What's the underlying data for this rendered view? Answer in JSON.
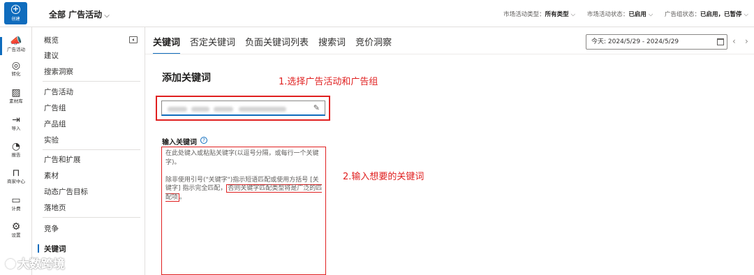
{
  "topbar": {
    "create_label": "创建",
    "campaign_selector": "全部 广告活动",
    "filters": [
      {
        "label": "市场活动类型：",
        "value": "所有类型"
      },
      {
        "label": "市场活动状态：",
        "value": "已启用"
      },
      {
        "label": "广告组状态：",
        "value": "已启用，已暂停"
      }
    ]
  },
  "rail": {
    "items": [
      {
        "label": "广告活动",
        "icon": "megaphone-icon"
      },
      {
        "label": "转化",
        "icon": "target-icon"
      },
      {
        "label": "素材库",
        "icon": "image-edit-icon"
      },
      {
        "label": "导入",
        "icon": "import-icon"
      },
      {
        "label": "报告",
        "icon": "chart-pie-icon"
      },
      {
        "label": "商家中心",
        "icon": "shopping-bag-icon"
      },
      {
        "label": "计费",
        "icon": "billing-icon"
      },
      {
        "label": "设置",
        "icon": "gear-icon"
      }
    ]
  },
  "nav": {
    "items": [
      "概览",
      "建议",
      "搜索洞察",
      "广告活动",
      "广告组",
      "产品组",
      "实验",
      "广告和扩展",
      "素材",
      "动态广告目标",
      "落地页",
      "竞争",
      "关键词"
    ],
    "active": "关键词"
  },
  "tabs": [
    "关键词",
    "否定关键词",
    "负面关键词列表",
    "搜索词",
    "竞价洞察"
  ],
  "date_range": "今天: 2024/5/29 - 2024/5/29",
  "main": {
    "section_title": "添加关键词",
    "annotation_1": "1.选择广告活动和广告组",
    "annotation_2": "2.输入想要的关键词",
    "keyword_label": "输入关键词",
    "placeholder_p1": "在此处键入或粘贴关键字(以逗号分隔，或每行一个关键字)。",
    "placeholder_p2_a": "除非使用引号(\"关键字\")指示短语匹配或使用方括号 [关键字] 指示完全匹配，",
    "placeholder_p2_b": "否则关键字匹配类型将是广泛的匹配项",
    "placeholder_p2_c": "。"
  },
  "watermark": "大数跨境",
  "colors": {
    "accent": "#0f6cbd",
    "annotation": "#e02020"
  }
}
